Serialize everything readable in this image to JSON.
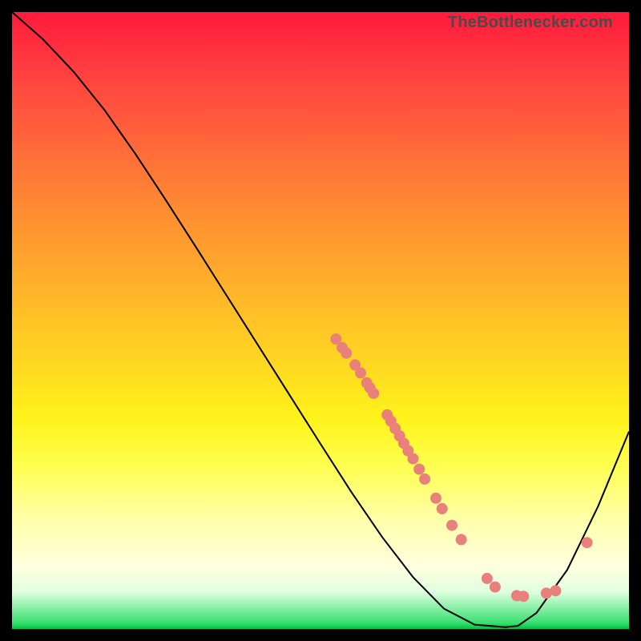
{
  "attribution": "TheBottlenecker.com",
  "colors": {
    "dot_fill": "#e9807b",
    "curve_stroke": "#000000"
  },
  "chart_data": {
    "type": "line",
    "title": "",
    "xlabel": "",
    "ylabel": "",
    "xlim": [
      0,
      100
    ],
    "ylim": [
      0,
      100
    ],
    "curve": [
      {
        "x": 0.0,
        "y": 100.0
      },
      {
        "x": 5.0,
        "y": 95.6
      },
      {
        "x": 10.0,
        "y": 90.3
      },
      {
        "x": 15.0,
        "y": 84.1
      },
      {
        "x": 20.0,
        "y": 77.0
      },
      {
        "x": 25.0,
        "y": 69.4
      },
      {
        "x": 30.0,
        "y": 61.6
      },
      {
        "x": 35.0,
        "y": 53.7
      },
      {
        "x": 40.0,
        "y": 45.8
      },
      {
        "x": 45.0,
        "y": 37.9
      },
      {
        "x": 50.0,
        "y": 30.0
      },
      {
        "x": 55.0,
        "y": 22.2
      },
      {
        "x": 60.0,
        "y": 14.9
      },
      {
        "x": 65.0,
        "y": 8.4
      },
      {
        "x": 70.0,
        "y": 3.3
      },
      {
        "x": 75.0,
        "y": 0.7
      },
      {
        "x": 80.0,
        "y": 0.3
      },
      {
        "x": 82.0,
        "y": 0.5
      },
      {
        "x": 85.0,
        "y": 2.6
      },
      {
        "x": 90.0,
        "y": 9.6
      },
      {
        "x": 95.0,
        "y": 19.9
      },
      {
        "x": 100.0,
        "y": 32.0
      }
    ],
    "scatter": [
      {
        "x": 52.5,
        "y": 47.0
      },
      {
        "x": 53.5,
        "y": 45.6
      },
      {
        "x": 54.2,
        "y": 44.7
      },
      {
        "x": 55.6,
        "y": 42.8
      },
      {
        "x": 56.5,
        "y": 41.5
      },
      {
        "x": 57.5,
        "y": 39.9
      },
      {
        "x": 58.0,
        "y": 39.1
      },
      {
        "x": 58.6,
        "y": 38.2
      },
      {
        "x": 60.8,
        "y": 34.7
      },
      {
        "x": 61.4,
        "y": 33.7
      },
      {
        "x": 62.1,
        "y": 32.5
      },
      {
        "x": 62.8,
        "y": 31.3
      },
      {
        "x": 63.5,
        "y": 30.1
      },
      {
        "x": 64.2,
        "y": 28.9
      },
      {
        "x": 65.0,
        "y": 27.6
      },
      {
        "x": 66.0,
        "y": 25.9
      },
      {
        "x": 66.9,
        "y": 24.3
      },
      {
        "x": 68.7,
        "y": 21.2
      },
      {
        "x": 69.7,
        "y": 19.5
      },
      {
        "x": 71.3,
        "y": 16.8
      },
      {
        "x": 72.8,
        "y": 14.5
      },
      {
        "x": 77.0,
        "y": 8.2
      },
      {
        "x": 78.3,
        "y": 6.8
      },
      {
        "x": 81.8,
        "y": 5.4
      },
      {
        "x": 82.9,
        "y": 5.3
      },
      {
        "x": 86.6,
        "y": 5.8
      },
      {
        "x": 88.1,
        "y": 6.2
      },
      {
        "x": 93.2,
        "y": 14.0
      }
    ]
  }
}
